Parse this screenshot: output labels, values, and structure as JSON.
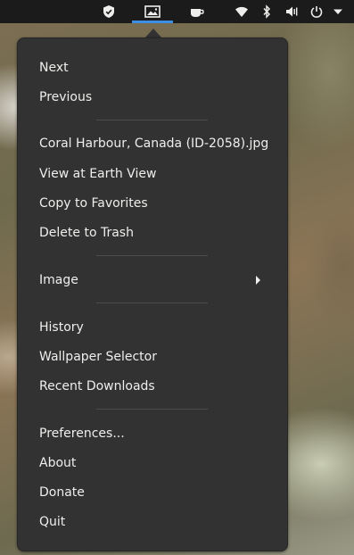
{
  "topbar": {
    "icons": [
      "shield-icon",
      "wallpaper-image-icon",
      "cup-icon",
      "wifi-icon",
      "bluetooth-icon",
      "volume-icon",
      "power-icon",
      "chevron-down-icon"
    ],
    "indicator_color": "#3d8fe6"
  },
  "menu": {
    "next": "Next",
    "previous": "Previous",
    "current_file": "Coral Harbour, Canada (ID-2058).jpg",
    "view_earth": "View at Earth View",
    "copy_favorites": "Copy to Favorites",
    "delete_trash": "Delete to Trash",
    "image": "Image",
    "history": "History",
    "wallpaper_selector": "Wallpaper Selector",
    "recent_downloads": "Recent Downloads",
    "preferences": "Preferences...",
    "about": "About",
    "donate": "Donate",
    "quit": "Quit"
  }
}
